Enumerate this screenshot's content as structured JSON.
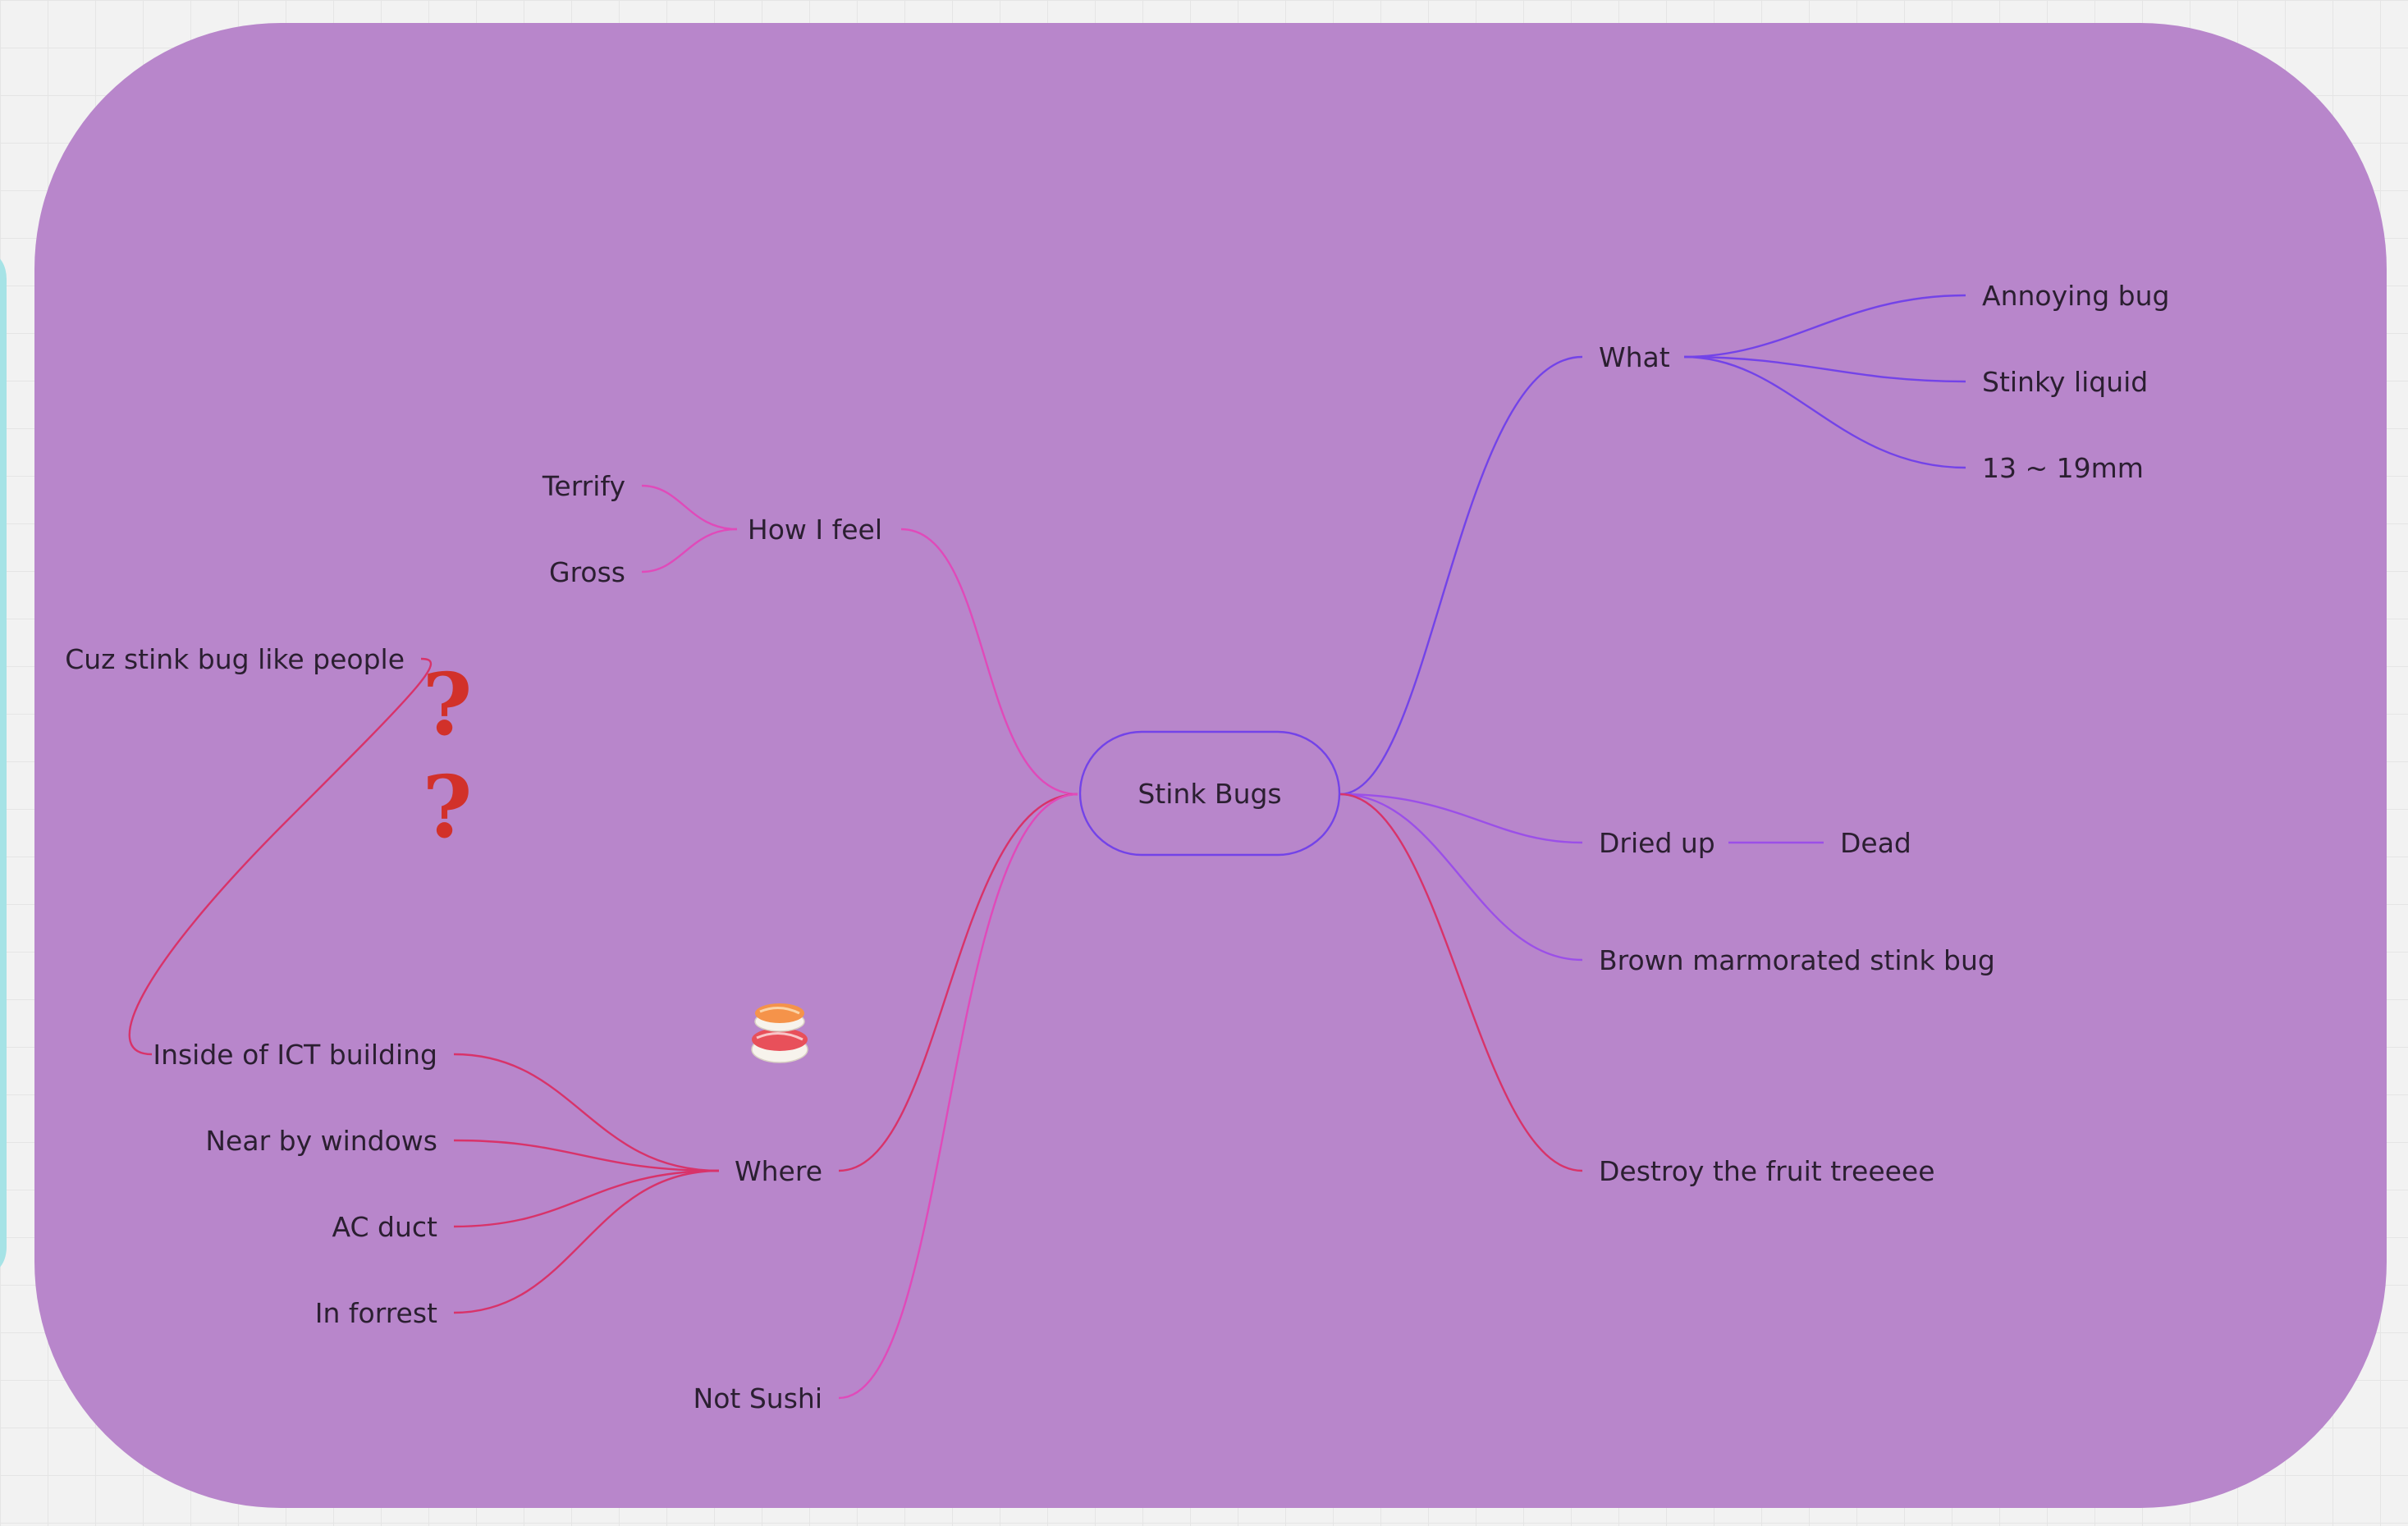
{
  "colors": {
    "background": "#f2f2f2",
    "frame_fill": "#b886cb",
    "side_accent": "#a6e3e6",
    "text": "#2b1f31",
    "branch_violet": "#7343e8",
    "branch_purple": "#9b4fe8",
    "branch_pink": "#e04aba",
    "branch_crimson": "#d8336a",
    "question_mark": "#d2312a"
  },
  "mindmap": {
    "root": {
      "label": "Stink Bugs"
    },
    "what": {
      "label": "What",
      "children": [
        "Annoying bug",
        "Stinky liquid",
        "13 ~ 19mm"
      ]
    },
    "dried_up": {
      "label": "Dried up",
      "child": "Dead"
    },
    "brown": {
      "label": "Brown marmorated stink bug"
    },
    "destroy": {
      "label": "Destroy the fruit treeeee"
    },
    "how_i_feel": {
      "label": "How I feel",
      "children": [
        "Terrify",
        "Gross"
      ]
    },
    "where": {
      "label": "Where",
      "children": [
        "Inside of ICT building",
        "Near by windows",
        "AC duct",
        "In forrest"
      ]
    },
    "not_sushi": {
      "label": "Not Sushi"
    },
    "cuz": {
      "label": "Cuz stink bug like people"
    },
    "decorations": {
      "question_mark_1": "?",
      "question_mark_2": "?",
      "sushi_icon": "sushi-icon"
    }
  }
}
